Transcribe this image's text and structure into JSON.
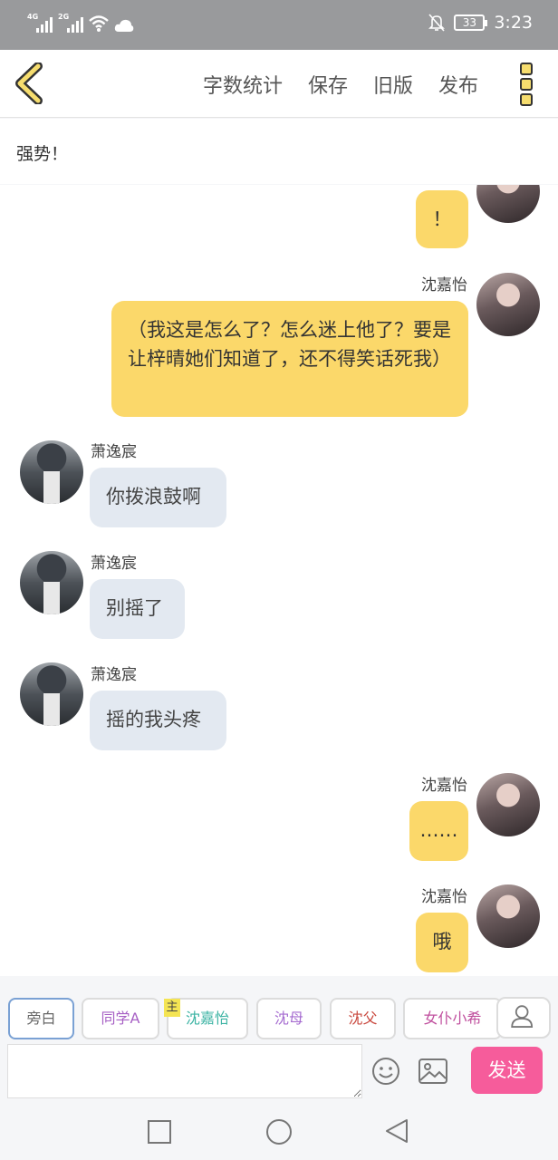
{
  "status_bar": {
    "sim1": "4G",
    "sim2": "2G",
    "battery": "33",
    "time": "3:23"
  },
  "topnav": {
    "actions": [
      "字数统计",
      "保存",
      "旧版",
      "发布"
    ]
  },
  "title": "强势！",
  "messages": [
    {
      "side": "me",
      "name": "",
      "text": "！"
    },
    {
      "side": "me",
      "name": "沈嘉怡",
      "text": "（我这是怎么了？怎么迷上他了？要是让梓晴她们知道了，还不得笑话死我）"
    },
    {
      "side": "other",
      "name": "萧逸宸",
      "text": "你拨浪鼓啊"
    },
    {
      "side": "other",
      "name": "萧逸宸",
      "text": "别摇了"
    },
    {
      "side": "other",
      "name": "萧逸宸",
      "text": "摇的我头疼"
    },
    {
      "side": "me",
      "name": "沈嘉怡",
      "text": "……"
    },
    {
      "side": "me",
      "name": "沈嘉怡",
      "text": "哦"
    }
  ],
  "characters": [
    {
      "label": "旁白",
      "color": "#666666",
      "active": true
    },
    {
      "label": "同学A",
      "color": "#a65fc4"
    },
    {
      "label": "沈嘉怡",
      "color": "#3bb3a3",
      "badge": "主"
    },
    {
      "label": "沈母",
      "color": "#a56bd0"
    },
    {
      "label": "沈父",
      "color": "#c9483e"
    },
    {
      "label": "女仆小希",
      "color": "#c04f9e"
    }
  ],
  "input": {
    "value": "",
    "send_label": "发送"
  },
  "colors": {
    "accent_yellow": "#fbd86a",
    "other_bubble": "#e3e9f1",
    "send_pink": "#f65c9b"
  }
}
